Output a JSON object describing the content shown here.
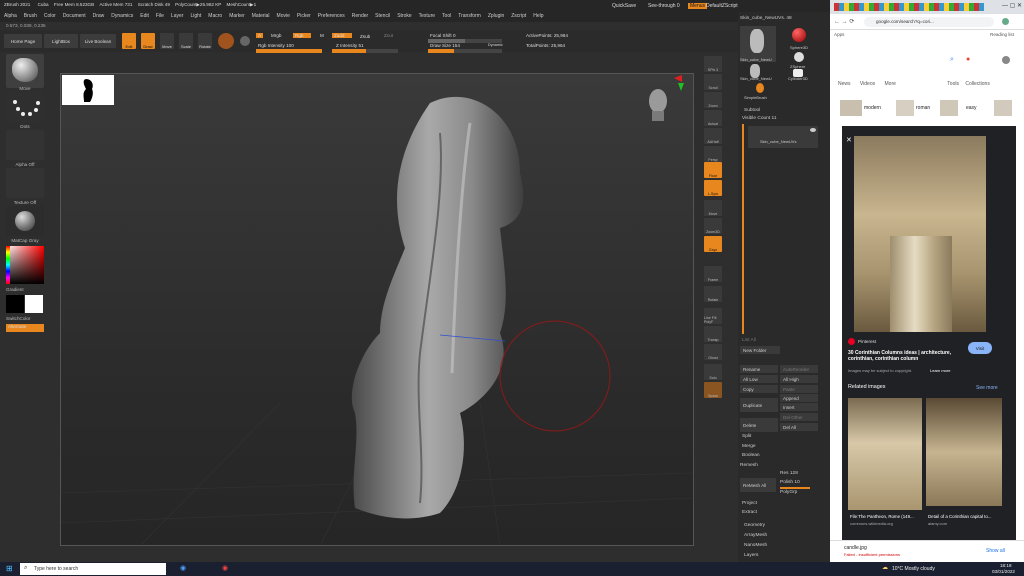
{
  "zbrush": {
    "title_bar": "ZBrush 2021",
    "title_stats": [
      "Cuba",
      "Free Mem 8.523GB",
      "Active Mem 731",
      "Scratch Disk 49",
      "PolyCount▶25.962 KP",
      "MeshCount▶1"
    ],
    "top_right": {
      "quicksave": "QuickSave",
      "seethrough": "See-through  0",
      "menus": "Menus",
      "default_script": "DefaultZScript"
    },
    "menu": [
      "Alpha",
      "Brush",
      "Color",
      "Document",
      "Draw",
      "Dynamics",
      "Edit",
      "File",
      "Layer",
      "Light",
      "Macro",
      "Marker",
      "Material",
      "Movie",
      "Picker",
      "Preferences",
      "Render",
      "Stencil",
      "Stroke",
      "Texture",
      "Tool",
      "Transform",
      "Zplugin",
      "Zscript",
      "Help"
    ],
    "coords": "0.573, 0.038, 0.235",
    "shelf": {
      "home": "Home Page",
      "lightbox": "LightBox",
      "live_boolean": "Live Boolean",
      "tools": [
        "Edit",
        "Draw",
        "Move",
        "Scale",
        "Rotate"
      ],
      "a_label": "A",
      "mrgb": "Mrgb",
      "rgb": "Rgb",
      "m": "M",
      "zadd": "Zadd",
      "zsub": "Zsub",
      "zcut": "Zcut",
      "rgb_intensity": "Rgb Intensity 100",
      "z_intensity": "Z Intensity 51",
      "focal_shift": "Focal Shift 0",
      "draw_size": "Draw Size 154",
      "dynamic": "Dynamic",
      "active_points": "ActivePoints: 25,964",
      "total_points": "TotalPoints: 25,964"
    },
    "left_panel": [
      "Move",
      "Dots",
      "Alpha Off",
      "Texture Off",
      "MatCap Gray",
      "Gradient",
      "SwitchColor",
      "Alternate"
    ],
    "right_tools": [
      "SPix 3",
      "Scroll",
      "Zoom",
      "Actual",
      "AAHalf",
      "Persp",
      "Floor",
      "L.Sym",
      "Gxyz",
      "Frame",
      "Move",
      "Zoom3D",
      "Rotate",
      "Line Fill PolyF",
      "Transp",
      "Ghost",
      "Solo",
      "Xpose"
    ],
    "subtool_panel": {
      "tool_name": "Skin_cube_NewUVs. 48",
      "thumbs": [
        "Skin_cube_NewU",
        "Sphere3D",
        "Skin_cube_NewU",
        "ZSphere",
        "Cylinder3D",
        "SimpleBrush"
      ],
      "subtool_title": "Subtool",
      "visible_count": "Visible Count 11",
      "subtool_item": "Skin_cube_NewUVs",
      "list_all": "List All",
      "new_folder": "New Folder",
      "buttons": [
        "Rename",
        "AutoReorder",
        "All Low",
        "All High",
        "Copy",
        "Paste",
        "Append",
        "Duplicate",
        "Insert",
        "Del Other",
        "Delete",
        "Del All",
        "Split",
        "Merge",
        "Boolean",
        "Remesh"
      ],
      "remesh_all": "ReMesh All",
      "res": "Res 128",
      "polish": "Polish 10",
      "polygrp": "PolyGrp",
      "project": "Project",
      "extract": "Extract",
      "sections": [
        "Geometry",
        "ArrayMesh",
        "NanoMesh",
        "Layers"
      ]
    }
  },
  "chrome": {
    "url": "google.com/search?q=cori...",
    "apps": "Apps",
    "reading_list": "Reading list",
    "tabs": [
      "News",
      "Videos",
      "More",
      "Tools",
      "Collections"
    ],
    "chips": [
      "modern",
      "roman",
      "easy"
    ],
    "source": "Pinterest",
    "result_title": "30 Corinthian Columns ideas | architecture, corinthian, corinthian column",
    "copyright": "Images may be subject to copyright.",
    "learn_more": "Learn more",
    "visit": "Visit",
    "related": "Related images",
    "see_more": "See more",
    "related_items": [
      {
        "title": "File:The Pantheon, Rome (149...",
        "source": "commons.wikimedia.org"
      },
      {
        "title": "Detail of a Corinthian capital to...",
        "source": "alamy.com"
      }
    ],
    "download_name": "candle.jpg",
    "download_status": "Failed - Insufficient permissions",
    "show_all": "Show all"
  },
  "taskbar": {
    "search": "Type here to search",
    "weather": "10°C  Mostly cloudy",
    "time": "18:18",
    "date": "03/01/2022"
  }
}
